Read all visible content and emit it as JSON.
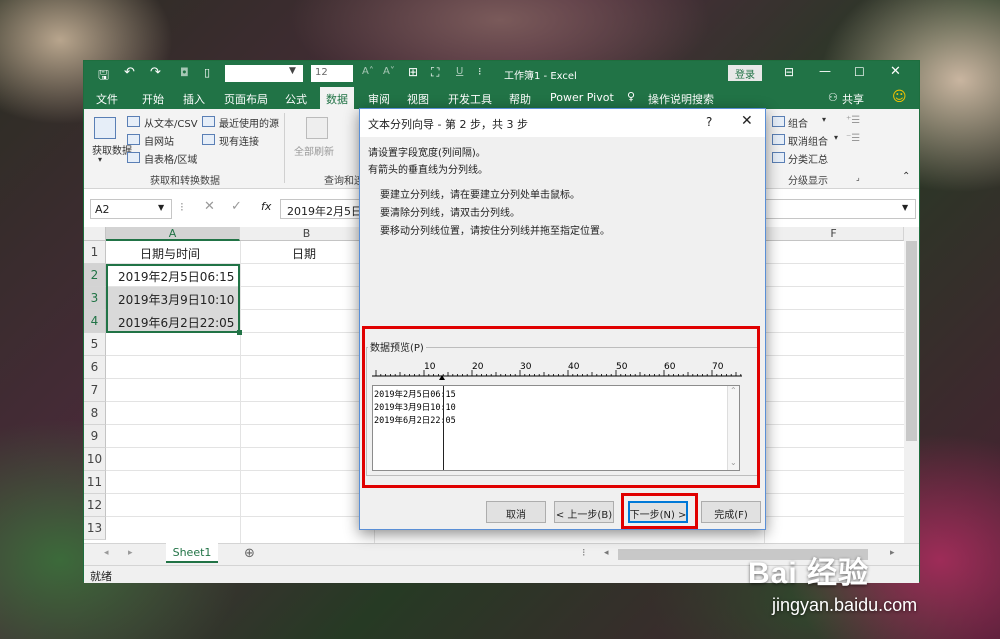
{
  "window": {
    "title": "工作簿1 - Excel",
    "login_label": "登录",
    "font_size": "12"
  },
  "menu": [
    "文件",
    "开始",
    "插入",
    "页面布局",
    "公式",
    "数据",
    "审阅",
    "视图",
    "开发工具",
    "帮助",
    "Power Pivot",
    "操作说明搜索"
  ],
  "menu_active": "数据",
  "share_label": "共享",
  "ribbon": {
    "get_data": "获取数据",
    "from_text": "从文本/CSV",
    "from_web": "自网站",
    "from_table": "自表格/区域",
    "recent_sources": "最近使用的源",
    "existing_conn": "现有连接",
    "group_get": "获取和转换数据",
    "refresh_all": "全部刷新",
    "group_query": "查询和连",
    "group_btn": "组合",
    "ungroup_btn": "取消组合",
    "subtotal_btn": "分类汇总",
    "group_outline": "分级显示"
  },
  "formula": {
    "namebox": "A2",
    "content": "2019年2月5日"
  },
  "grid": {
    "columns": [
      "A",
      "B",
      "F"
    ],
    "rows": [
      "1",
      "2",
      "3",
      "4",
      "5",
      "6",
      "7",
      "8",
      "9",
      "10",
      "11",
      "12",
      "13"
    ],
    "a1": "日期与时间",
    "b1": "日期",
    "a_values": [
      "2019年2月5日06:15",
      "2019年3月9日10:10",
      "2019年6月2日22:05"
    ]
  },
  "sheet_tab": "Sheet1",
  "status": "就绪",
  "dialog": {
    "title": "文本分列向导 - 第 2 步，共 3 步",
    "help": "?",
    "intro1": "请设置字段宽度(列间隔)。",
    "intro2": "有箭头的垂直线为分列线。",
    "tip1": "要建立分列线，请在要建立分列处单击鼠标。",
    "tip2": "要清除分列线，请双击分列线。",
    "tip3": "要移动分列线位置，请按住分列线并拖至指定位置。",
    "preview_label": "数据预览(P)",
    "ruler_ticks": [
      "10",
      "20",
      "30",
      "40",
      "50",
      "60",
      "70"
    ],
    "preview_lines": [
      "2019年2月5日06:15",
      "2019年3月9日10:10",
      "2019年6月2日22:05"
    ],
    "btn_cancel": "取消",
    "btn_prev": "< 上一步(B)",
    "btn_next": "下一步(N) >",
    "btn_finish": "完成(F)"
  },
  "watermark": {
    "brand": "Bai 经验",
    "url": "jingyan.baidu.com"
  }
}
